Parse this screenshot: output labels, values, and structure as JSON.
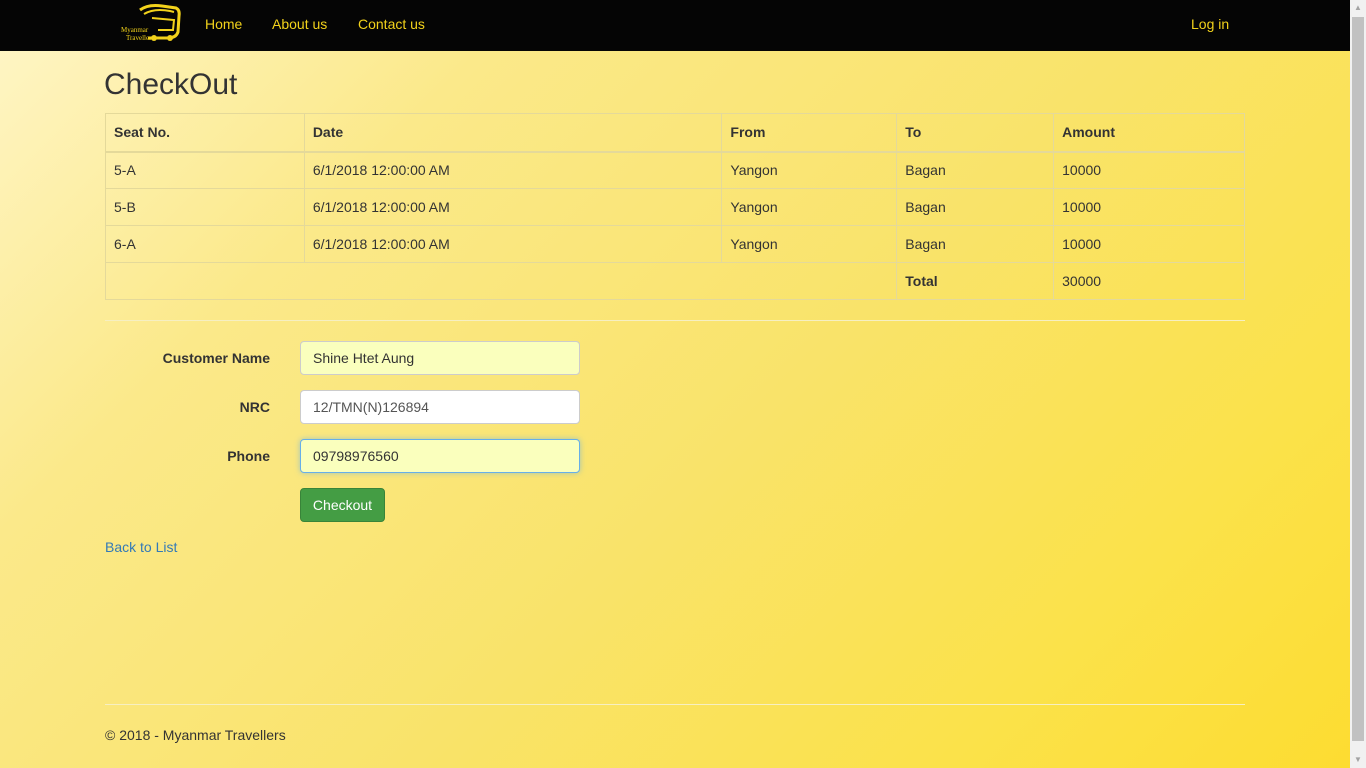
{
  "nav": {
    "logo_text_1": "Myanmar",
    "logo_text_2": "Travellers",
    "links": [
      "Home",
      "About us",
      "Contact us"
    ],
    "login": "Log in",
    "logo_color": "#f2d21b"
  },
  "page": {
    "title": "CheckOut"
  },
  "table": {
    "headers": [
      "Seat No.",
      "Date",
      "From",
      "To",
      "Amount"
    ],
    "rows": [
      [
        "5-A",
        "6/1/2018 12:00:00 AM",
        "Yangon",
        "Bagan",
        "10000"
      ],
      [
        "5-B",
        "6/1/2018 12:00:00 AM",
        "Yangon",
        "Bagan",
        "10000"
      ],
      [
        "6-A",
        "6/1/2018 12:00:00 AM",
        "Yangon",
        "Bagan",
        "10000"
      ]
    ],
    "total_label": "Total",
    "total_value": "30000"
  },
  "form": {
    "customer_name_label": "Customer Name",
    "customer_name_value": "Shine Htet Aung",
    "nrc_label": "NRC",
    "nrc_value": "12/TMN(N)126894",
    "phone_label": "Phone",
    "phone_value": "09798976560",
    "checkout_button": "Checkout"
  },
  "back_link": "Back to List",
  "footer": "© 2018 - Myanmar Travellers"
}
